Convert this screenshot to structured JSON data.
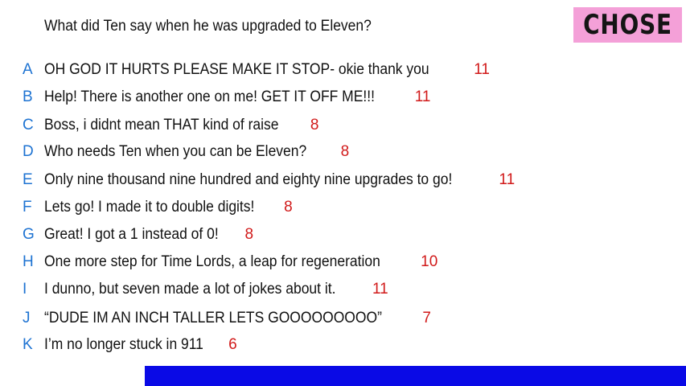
{
  "question": "What did Ten say when he was upgraded to Eleven?",
  "badge": {
    "label": "CHOSE",
    "color": "#f4a0d8"
  },
  "options": [
    {
      "letter": "A",
      "text": "OH GOD IT HURTS PLEASE MAKE IT STOP- okie thank you",
      "count": "11"
    },
    {
      "letter": "B",
      "text": "Help! There is another one on me! GET IT OFF ME!!!",
      "count": "11"
    },
    {
      "letter": "C",
      "text": "Boss, i didnt mean THAT  kind of raise",
      "count": "8"
    },
    {
      "letter": "D",
      "text": "Who needs Ten when you can be Eleven?",
      "count": "8"
    },
    {
      "letter": "E",
      "text": "Only nine thousand nine hundred and eighty nine upgrades to go!",
      "count": "11"
    },
    {
      "letter": "F",
      "text": "Lets go! I made it to double digits!",
      "count": "8"
    },
    {
      "letter": "G",
      "text": "Great! I got a 1 instead of 0!",
      "count": "8"
    },
    {
      "letter": "H",
      "text": "One more step for Time Lords, a leap for regeneration",
      "count": "10"
    },
    {
      "letter": "I",
      "text": "I dunno, but seven made a lot of jokes about it.",
      "count": "11"
    },
    {
      "letter": "J",
      "text": "“DUDE IM AN INCH TALLER LETS GOOOOOOOOO”",
      "count": "7"
    },
    {
      "letter": "K",
      "text": "I’m no longer stuck in 911",
      "count": "6"
    }
  ],
  "colors": {
    "letter": "#1e73d2",
    "count": "#d11a1a",
    "bottom_bar": "#0a0ae6"
  }
}
